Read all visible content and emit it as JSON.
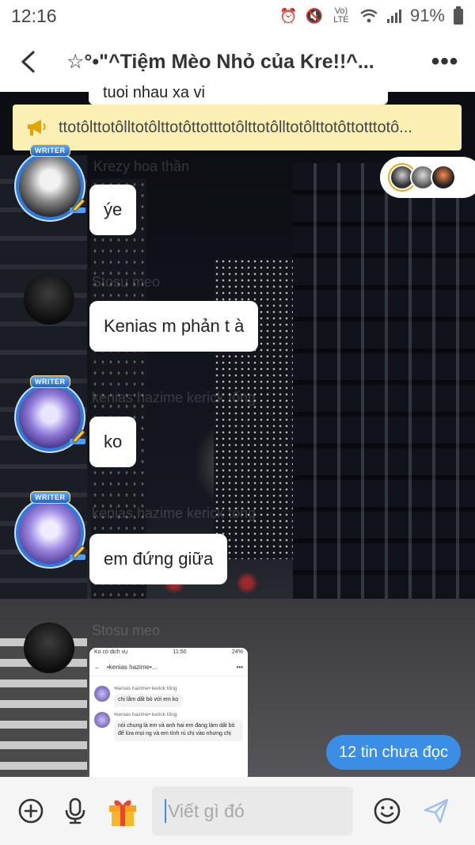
{
  "status_bar": {
    "time": "12:16",
    "network": "Vo) LTE",
    "battery": "91%"
  },
  "header": {
    "title": "☆°•\"^Tiệm Mèo Nhỏ của Kre!!^...",
    "more": "•••"
  },
  "prev_message_fragment": "tuoi nhau xa vi",
  "announcement": {
    "text": "ttotôlttotôlltotôlttotôttotttotôlttotôlltotôlttotôttotttotô..."
  },
  "participants": [
    {
      "name": "Krezy hoa thần",
      "writer": true
    },
    {
      "name": "Stosu meo"
    },
    {
      "name": "kenias hazime kerick tống",
      "writer": true
    },
    {
      "name": "kenias hazime kerick tống",
      "writer": true
    },
    {
      "name": "Stosu meo"
    }
  ],
  "messages": [
    {
      "text": "ýe"
    },
    {
      "text": "Kenias m phản t à"
    },
    {
      "text": "ko"
    },
    {
      "text": "em đứng giữa"
    }
  ],
  "writer_badge": "WRITER",
  "screenshot": {
    "carrier": "Ko có dịch vụ",
    "time": "11:50",
    "battery": "24%",
    "title": "•kenias hazime•...",
    "msg1_name": "•kenias hazime• kerick tống",
    "msg1_text": "chị lằm dất bò với em ko",
    "msg2_name": "•kenias hazime• kerick tống",
    "msg2_text": "nói chung là em và anh hai em đang làm dất bò để lừa mọi ng và em tính rủ chị vào nhưng chị"
  },
  "unread": {
    "label": "12 tin chưa đọc"
  },
  "input": {
    "placeholder": "Viết gì đó"
  },
  "icons": {
    "back": "back-arrow-icon",
    "announce": "megaphone-icon",
    "plus": "plus-circle-icon",
    "mic": "microphone-icon",
    "gift": "gift-icon",
    "emoji": "smiley-icon",
    "send": "send-icon"
  },
  "colors": {
    "accent": "#3a8ee6",
    "announcement_bg": "#fcefb4",
    "writer_ring": "#2b7be0"
  }
}
